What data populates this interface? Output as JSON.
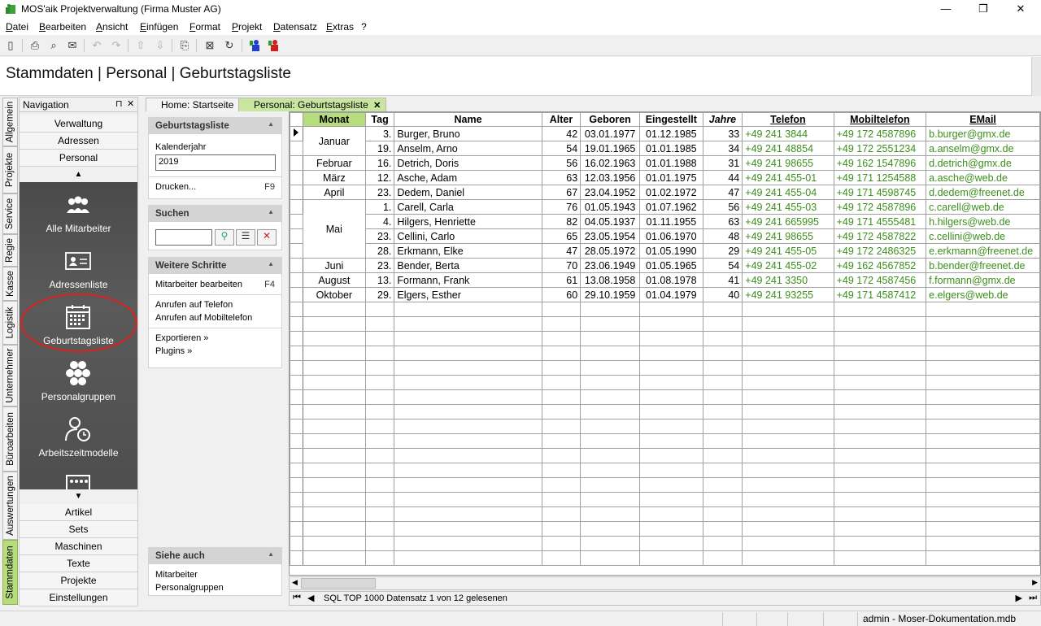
{
  "window": {
    "title": "MOS'aik Projektverwaltung (Firma Muster AG)",
    "minimize": "—",
    "restore": "❐",
    "close": "✕"
  },
  "menu": [
    "Datei",
    "Bearbeiten",
    "Ansicht",
    "Einfügen",
    "Format",
    "Projekt",
    "Datensatz",
    "Extras",
    "?"
  ],
  "header": {
    "title": "Stammdaten | Personal | Geburtstagsliste"
  },
  "vertical_tabs": [
    "Allgemein",
    "Projekte",
    "Service",
    "Regie",
    "Kasse",
    "Logistik",
    "Unternehmer",
    "Büroarbeiten",
    "Auswertungen",
    "Stammdaten"
  ],
  "navigation": {
    "title": "Navigation",
    "pin": "⊓",
    "close": "✕",
    "top_buttons": [
      "Verwaltung",
      "Adressen",
      "Personal"
    ],
    "items": [
      "Alle Mitarbeiter",
      "Adressenliste",
      "Geburtstagsliste",
      "Personalgruppen",
      "Arbeitszeitmodelle"
    ],
    "bottom_buttons": [
      "Artikel",
      "Sets",
      "Maschinen",
      "Texte",
      "Projekte",
      "Einstellungen"
    ]
  },
  "tabs": [
    {
      "label": "Home: Startseite"
    },
    {
      "label": "Personal: Geburtstagsliste",
      "close": "✕"
    }
  ],
  "side": {
    "geburtstagsliste": {
      "title": "Geburtstagsliste",
      "year_label": "Kalenderjahr",
      "year_value": "2019",
      "print": "Drucken...",
      "print_key": "F9"
    },
    "suchen": {
      "title": "Suchen",
      "search_value": ""
    },
    "weitere": {
      "title": "Weitere Schritte",
      "edit": "Mitarbeiter bearbeiten",
      "edit_key": "F4",
      "call_phone": "Anrufen auf Telefon",
      "call_mobile": "Anrufen auf Mobiltelefon",
      "export": "Exportieren »",
      "plugins": "Plugins »"
    },
    "siehe": {
      "title": "Siehe auch",
      "link1": "Mitarbeiter",
      "link2": "Personalgruppen"
    }
  },
  "grid": {
    "columns": [
      "Monat",
      "Tag",
      "Name",
      "Alter",
      "Geboren",
      "Eingestellt",
      "Jahre",
      "Telefon",
      "Mobiltelefon",
      "EMail"
    ],
    "rows": [
      {
        "monat": "Januar",
        "span": 2,
        "tag": "3.",
        "name": "Burger, Bruno",
        "alter": "42",
        "geboren": "03.01.1977",
        "eingestellt": "01.12.1985",
        "jahre": "33",
        "telefon": "+49 241 3844",
        "mobil": "+49 172 4587896",
        "email": "b.burger@gmx.de"
      },
      {
        "tag": "19.",
        "name": "Anselm, Arno",
        "alter": "54",
        "geboren": "19.01.1965",
        "eingestellt": "01.01.1985",
        "jahre": "34",
        "telefon": "+49 241 48854",
        "mobil": "+49 172 2551234",
        "email": "a.anselm@gmx.de"
      },
      {
        "monat": "Februar",
        "span": 1,
        "tag": "16.",
        "name": "Detrich, Doris",
        "alter": "56",
        "geboren": "16.02.1963",
        "eingestellt": "01.01.1988",
        "jahre": "31",
        "telefon": "+49 241 98655",
        "mobil": "+49 162 1547896",
        "email": "d.detrich@gmx.de"
      },
      {
        "monat": "März",
        "span": 1,
        "tag": "12.",
        "name": "Asche, Adam",
        "alter": "63",
        "geboren": "12.03.1956",
        "eingestellt": "01.01.1975",
        "jahre": "44",
        "telefon": "+49 241 455-01",
        "mobil": "+49 171 1254588",
        "email": "a.asche@web.de"
      },
      {
        "monat": "April",
        "span": 1,
        "tag": "23.",
        "name": "Dedem, Daniel",
        "alter": "67",
        "geboren": "23.04.1952",
        "eingestellt": "01.02.1972",
        "jahre": "47",
        "telefon": "+49 241 455-04",
        "mobil": "+49 171 4598745",
        "email": "d.dedem@freenet.de"
      },
      {
        "monat": "Mai",
        "span": 4,
        "tag": "1.",
        "name": "Carell, Carla",
        "alter": "76",
        "geboren": "01.05.1943",
        "eingestellt": "01.07.1962",
        "jahre": "56",
        "telefon": "+49 241 455-03",
        "mobil": "+49 172 4587896",
        "email": "c.carell@web.de"
      },
      {
        "tag": "4.",
        "name": "Hilgers, Henriette",
        "alter": "82",
        "geboren": "04.05.1937",
        "eingestellt": "01.11.1955",
        "jahre": "63",
        "telefon": "+49 241 665995",
        "mobil": "+49 171 4555481",
        "email": "h.hilgers@web.de"
      },
      {
        "tag": "23.",
        "name": "Cellini, Carlo",
        "alter": "65",
        "geboren": "23.05.1954",
        "eingestellt": "01.06.1970",
        "jahre": "48",
        "telefon": "+49 241 98655",
        "mobil": "+49 172 4587822",
        "email": "c.cellini@web.de"
      },
      {
        "tag": "28.",
        "name": "Erkmann, Elke",
        "alter": "47",
        "geboren": "28.05.1972",
        "eingestellt": "01.05.1990",
        "jahre": "29",
        "telefon": "+49 241 455-05",
        "mobil": "+49 172 2486325",
        "email": "e.erkmann@freenet.de"
      },
      {
        "monat": "Juni",
        "span": 1,
        "tag": "23.",
        "name": "Bender, Berta",
        "alter": "70",
        "geboren": "23.06.1949",
        "eingestellt": "01.05.1965",
        "jahre": "54",
        "telefon": "+49 241 455-02",
        "mobil": "+49 162 4567852",
        "email": "b.bender@freenet.de"
      },
      {
        "monat": "August",
        "span": 1,
        "tag": "13.",
        "name": "Formann, Frank",
        "alter": "61",
        "geboren": "13.08.1958",
        "eingestellt": "01.08.1978",
        "jahre": "41",
        "telefon": "+49 241 3350",
        "mobil": "+49 172 4587456",
        "email": "f.formann@gmx.de"
      },
      {
        "monat": "Oktober",
        "span": 1,
        "tag": "29.",
        "name": "Elgers, Esther",
        "alter": "60",
        "geboren": "29.10.1959",
        "eingestellt": "01.04.1979",
        "jahre": "40",
        "telefon": "+49 241 93255",
        "mobil": "+49 171 4587412",
        "email": "e.elgers@web.de"
      }
    ]
  },
  "record_nav": {
    "text": "SQL TOP 1000 Datensatz 1 von 12 gelesenen"
  },
  "status": {
    "right": "admin - Moser-Dokumentation.mdb"
  },
  "colors": {
    "accent": "#b7dc7e",
    "link_green": "#3c8f1b",
    "highlight": "#e0201e"
  }
}
